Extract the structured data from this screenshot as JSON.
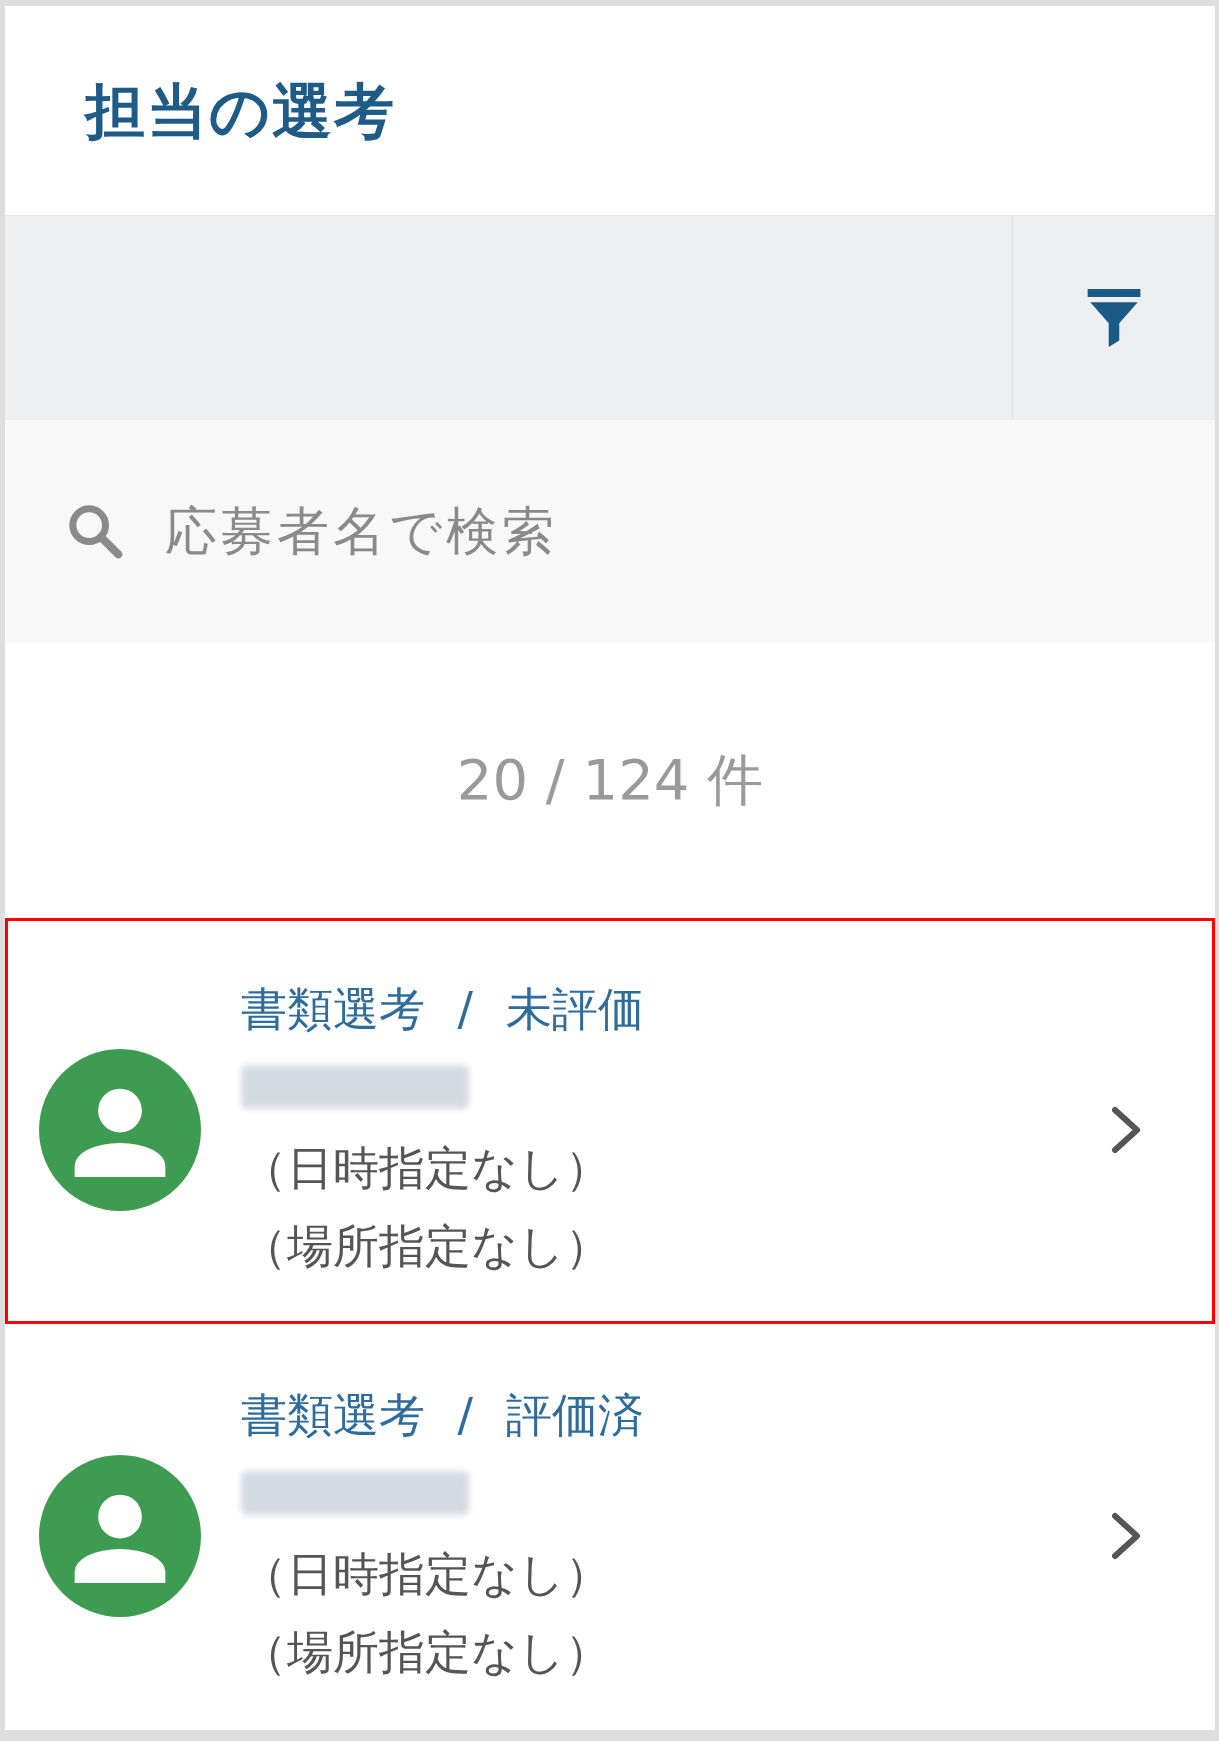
{
  "header": {
    "title": "担当の選考"
  },
  "search": {
    "placeholder": "応募者名で検索"
  },
  "result_count": "20 / 124 件",
  "candidates": [
    {
      "selected": true,
      "status_line": "書類選考 / 未評価",
      "schedule": "（日時指定なし）",
      "location": "（場所指定なし）"
    },
    {
      "selected": false,
      "status_line": "書類選考 / 評価済",
      "schedule": "（日時指定なし）",
      "location": "（場所指定なし）"
    }
  ]
}
